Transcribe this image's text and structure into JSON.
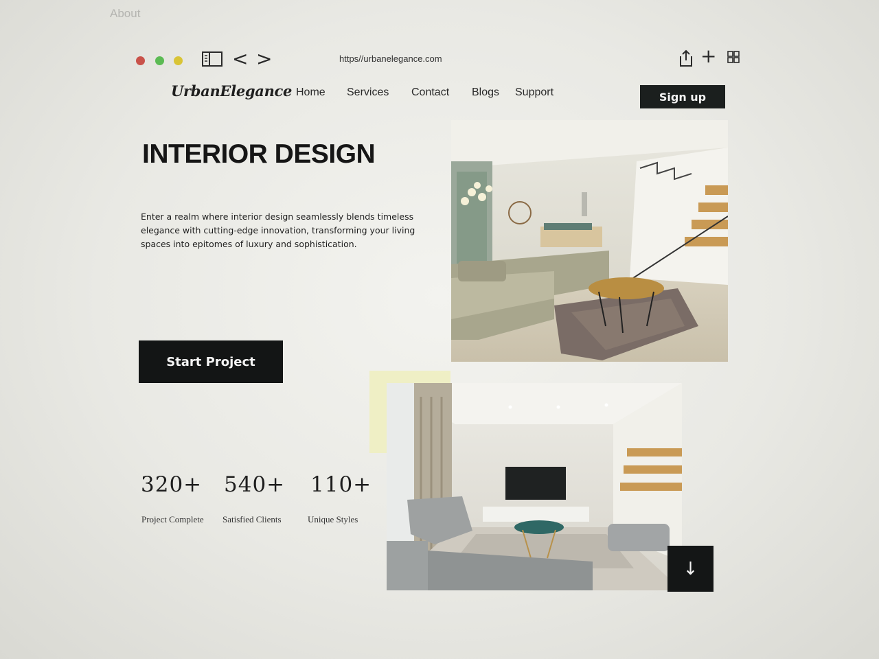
{
  "background_text": "About",
  "browser": {
    "url": "https//urbanelegance.com",
    "traffic_lights": {
      "close": "#c9524a",
      "maximize": "#5cbb54",
      "minimize": "#d9c436"
    },
    "icons": {
      "sidebar": "sidebar-icon",
      "back": "<",
      "forward": ">",
      "share": "share-icon",
      "new_tab": "+",
      "tabs": "tab-grid-icon"
    }
  },
  "site": {
    "logo": "UrbanElegance",
    "nav": [
      "Home",
      "Services",
      "Contact",
      "Blogs",
      "Support"
    ],
    "signup_label": "Sign up"
  },
  "hero": {
    "title": "INTERIOR DESIGN",
    "description": "Enter a realm where interior design seamlessly blends timeless elegance with cutting-edge innovation, transforming your living spaces into epitomes of luxury and sophistication.",
    "cta_label": "Start Project"
  },
  "stats": [
    {
      "value": "320+",
      "label": "Project Complete"
    },
    {
      "value": "540+",
      "label": "Satisfied Clients"
    },
    {
      "value": "110+",
      "label": "Unique Styles"
    }
  ],
  "images": {
    "top": "living-room-with-staircase-photo",
    "bottom": "tv-lounge-photo"
  },
  "scroll_button_icon": "↓",
  "colors": {
    "accent_dark": "#141616",
    "accent_highlight": "#efefb8"
  }
}
